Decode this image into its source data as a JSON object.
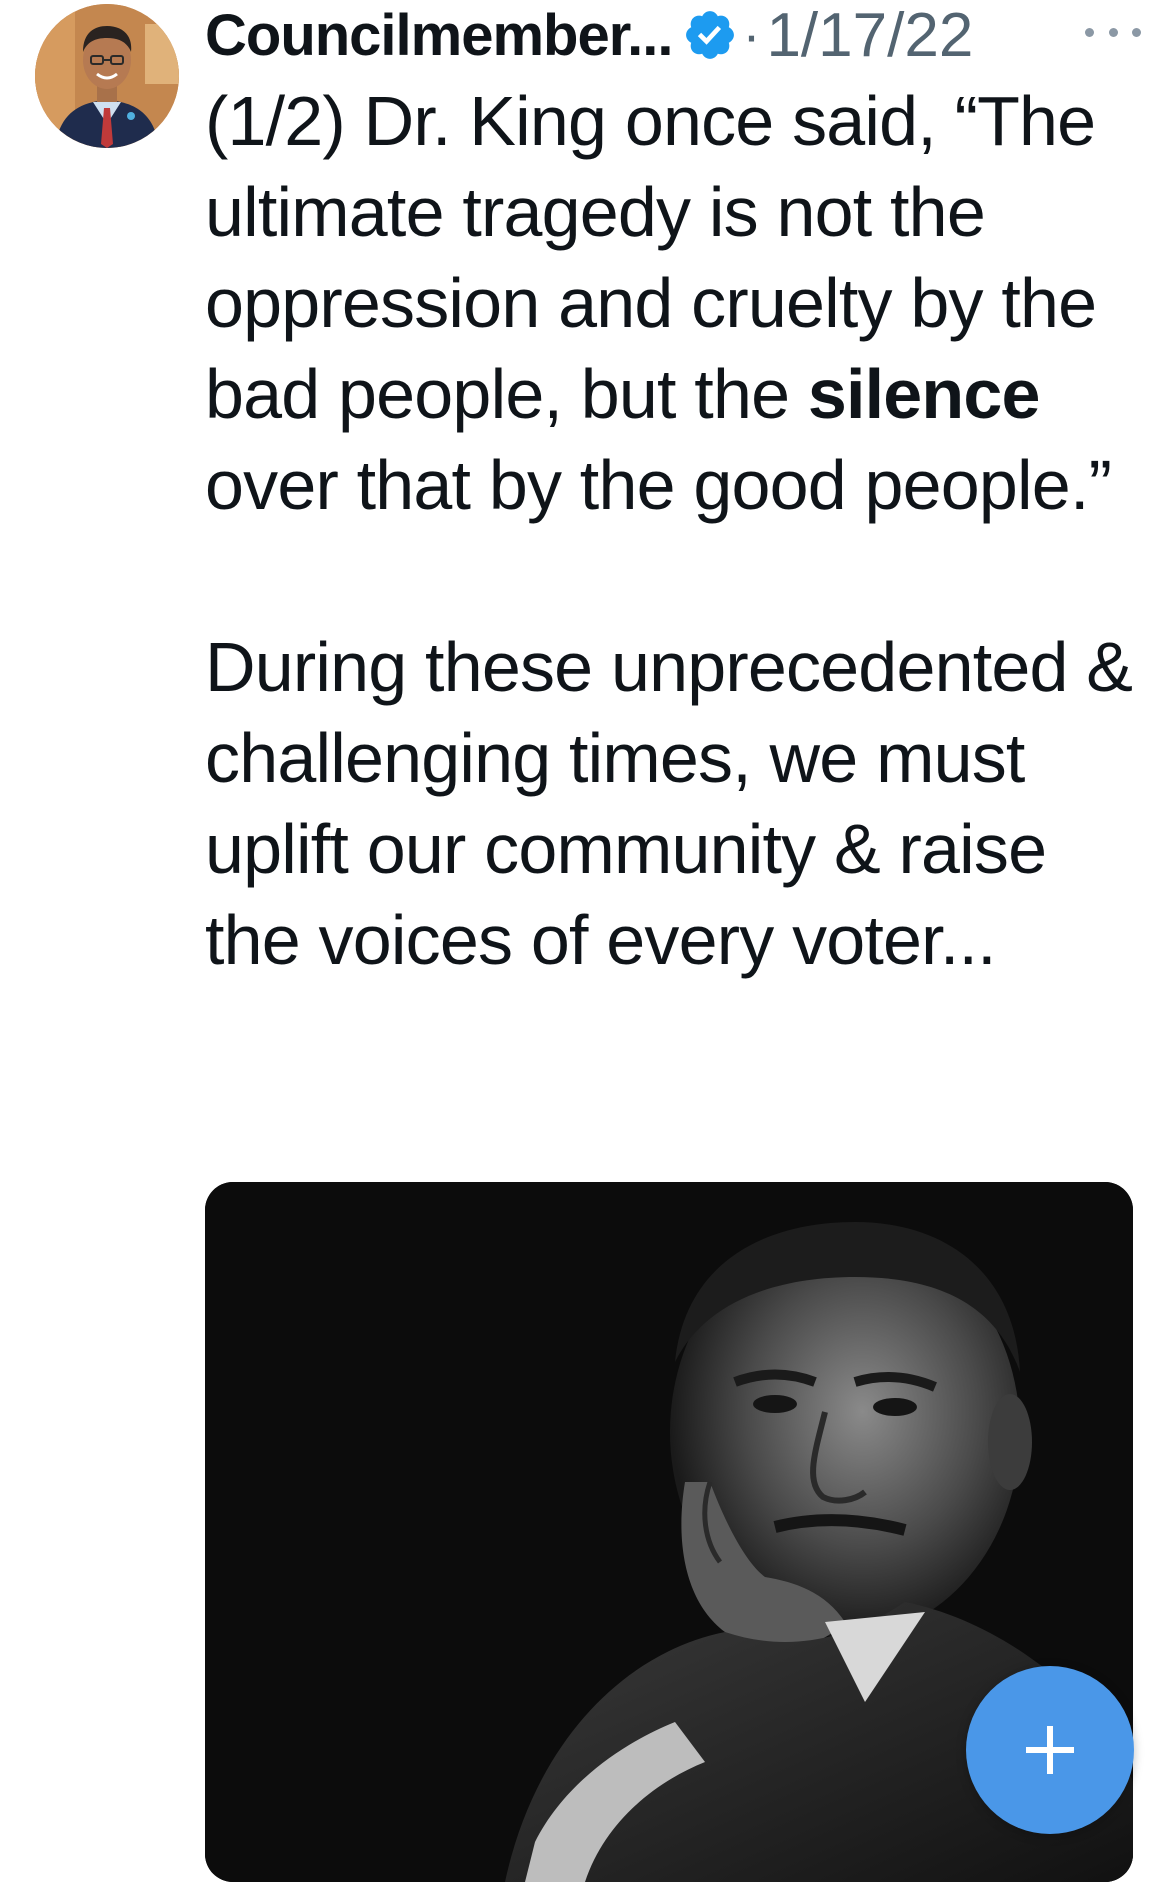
{
  "tweet": {
    "author_name": "Councilmember...",
    "separator": "·",
    "date": "1/17/22",
    "body": {
      "p1_part1": "(1/2) Dr. King once said, “The ultimate tragedy is not the oppression and cruelty by the bad people, but the ",
      "p1_bold": "silence",
      "p1_part2": " over that by the good people.”",
      "p2": "During these unprecedented & challenging times, we must uplift our community & raise the voices of every voter..."
    },
    "icons": {
      "verified": "verified-badge-icon",
      "more": "more-options-icon",
      "compose": "plus-icon"
    }
  },
  "colors": {
    "verified_blue": "#1d9bf0",
    "fab_blue": "#4a97e8",
    "secondary_text": "#536471"
  }
}
